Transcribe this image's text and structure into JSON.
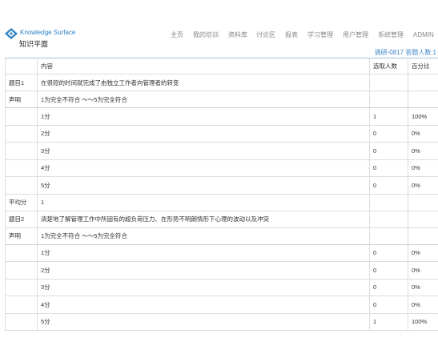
{
  "brand": {
    "logo_icon": "knowledge-surface-logo",
    "name_en": "Knowledge Surface",
    "name_cn": "知识平面",
    "color": "#2d82c6"
  },
  "nav": {
    "items": [
      {
        "label": "主页"
      },
      {
        "label": "我的培训"
      },
      {
        "label": "资料库"
      },
      {
        "label": "讨论区"
      },
      {
        "label": "报表"
      },
      {
        "label": "学习管理"
      },
      {
        "label": "用户管理"
      },
      {
        "label": "系统管理"
      },
      {
        "label": "ADMIN"
      }
    ]
  },
  "survey": {
    "info": "调研-0817 答题人数:1"
  },
  "table": {
    "columns": {
      "key": "",
      "content": "内容",
      "count": "选取人数",
      "percent": "百分比"
    },
    "questions": [
      {
        "key": "题目1",
        "title": "在很短的时间就完成了由独立工作者向管理者的转变",
        "statement_key": "声明",
        "statement": "1为完全不符合 ～～5为完全符合",
        "options": [
          {
            "label": "1分",
            "count": "1",
            "percent": "100%"
          },
          {
            "label": "2分",
            "count": "0",
            "percent": "0%"
          },
          {
            "label": "3分",
            "count": "0",
            "percent": "0%"
          },
          {
            "label": "4分",
            "count": "0",
            "percent": "0%"
          },
          {
            "label": "5分",
            "count": "0",
            "percent": "0%"
          }
        ],
        "average_key": "平均分",
        "average": "1"
      },
      {
        "key": "题目2",
        "title": "清楚地了解管理工作中所固有的超负荷压力、在形势不明朗情形下心理的波动以及冲突",
        "statement_key": "声明",
        "statement": "1为完全不符合 ～～5为完全符合",
        "options": [
          {
            "label": "1分",
            "count": "0",
            "percent": "0%"
          },
          {
            "label": "2分",
            "count": "0",
            "percent": "0%"
          },
          {
            "label": "3分",
            "count": "0",
            "percent": "0%"
          },
          {
            "label": "4分",
            "count": "0",
            "percent": "0%"
          },
          {
            "label": "5分",
            "count": "1",
            "percent": "100%"
          }
        ]
      }
    ]
  },
  "colors": {
    "accent": "#3d86c6",
    "nav_text": "#888888",
    "border": "#dddddd"
  }
}
